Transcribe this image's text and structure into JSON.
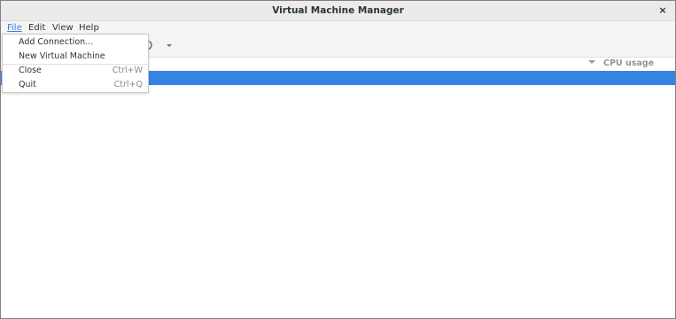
{
  "window": {
    "title": "Virtual Machine Manager",
    "close_glyph": "×"
  },
  "menubar": {
    "items": [
      {
        "label": "File",
        "active": true
      },
      {
        "label": "Edit"
      },
      {
        "label": "View"
      },
      {
        "label": "Help"
      }
    ]
  },
  "toolbar": {
    "icons": [
      "power-icon",
      "chevron-down-icon"
    ]
  },
  "columns": {
    "cpu_usage": "CPU usage",
    "sort_icon": "sort-descending-icon"
  },
  "file_menu": {
    "items": [
      {
        "label": "Add Connection...",
        "accel": ""
      },
      {
        "label": "New Virtual Machine",
        "accel": ""
      },
      {
        "label": "Close",
        "accel": "Ctrl+W"
      },
      {
        "label": "Quit",
        "accel": "Ctrl+Q"
      }
    ]
  },
  "colors": {
    "accent": "#3584e4",
    "titlebar_bg": "#ebebeb",
    "menubar_bg": "#f6f5f4",
    "window_border": "#8c7a80"
  }
}
